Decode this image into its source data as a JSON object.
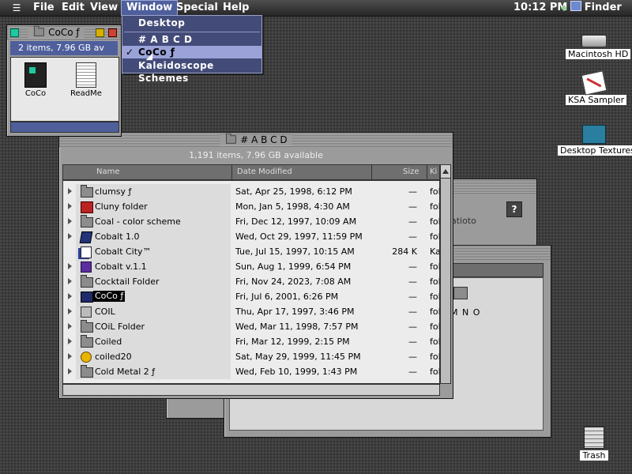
{
  "menubar": {
    "apple": "☰",
    "items": [
      "File",
      "Edit",
      "View",
      "Window",
      "Special",
      "Help"
    ],
    "clock": "10:12 PM",
    "app": "Finder"
  },
  "window_menu": {
    "items": [
      "Desktop",
      "# A B C D",
      "CoCo ƒ",
      "Kaleidoscope Schemes"
    ],
    "checked": "✓"
  },
  "coco_window": {
    "title": "CoCo ƒ",
    "status": "2 items, 7.96 GB av",
    "icons": [
      "CoCo",
      "ReadMe"
    ]
  },
  "main_window": {
    "title": "# A B C D",
    "status": "1,191 items, 7.96 GB available",
    "columns": {
      "name": "Name",
      "date": "Date Modified",
      "size": "Size",
      "kind": "Ki"
    },
    "rows": [
      {
        "name": "clumsy ƒ",
        "date": "Sat, Apr 25, 1998, 6:12 PM",
        "size": "—",
        "kind": "fol"
      },
      {
        "name": "Cluny folder",
        "date": "Mon, Jan 5, 1998, 4:30 AM",
        "size": "—",
        "kind": "fol"
      },
      {
        "name": "Coal - color scheme",
        "date": "Fri, Dec 12, 1997, 10:09 AM",
        "size": "—",
        "kind": "fol"
      },
      {
        "name": "Cobalt 1.0",
        "date": "Wed, Oct 29, 1997, 11:59 PM",
        "size": "—",
        "kind": "fol"
      },
      {
        "name": "Cobalt City™",
        "date": "Tue, Jul 15, 1997, 10:15 AM",
        "size": "284 K",
        "kind": "Ka"
      },
      {
        "name": "Cobalt v.1.1",
        "date": "Sun, Aug 1, 1999, 6:54 PM",
        "size": "—",
        "kind": "fol"
      },
      {
        "name": "Cocktail Folder",
        "date": "Fri, Nov 24, 2023, 7:08 AM",
        "size": "—",
        "kind": "fol"
      },
      {
        "name": "CoCo ƒ",
        "date": "Fri, Jul 6, 2001, 6:26 PM",
        "size": "—",
        "kind": "fol"
      },
      {
        "name": "COIL",
        "date": "Thu, Apr 17, 1997, 3:46 PM",
        "size": "—",
        "kind": "fol"
      },
      {
        "name": "COiL Folder",
        "date": "Wed, Mar 11, 1998, 7:57 PM",
        "size": "—",
        "kind": "fol"
      },
      {
        "name": "Coiled",
        "date": "Fri, Mar 12, 1999, 2:15 PM",
        "size": "—",
        "kind": "fol"
      },
      {
        "name": "coiled20",
        "date": "Sat, May 29, 1999, 11:45 PM",
        "size": "—",
        "kind": "fol"
      },
      {
        "name": "Cold Metal 2 ƒ",
        "date": "Wed, Feb 10, 1999, 1:43 PM",
        "size": "—",
        "kind": "fol"
      }
    ]
  },
  "back_windows": {
    "help": "?",
    "fragment1": "atioto",
    "fragment2": "M N O"
  },
  "desktop": {
    "icons": [
      "Macintosh HD",
      "KSA Sampler",
      "Desktop Textures",
      "Trash"
    ]
  },
  "colors": {
    "highlight": "#4e5f9c",
    "menu_bg": "#434c78",
    "desktop": "#3d3d3d"
  }
}
